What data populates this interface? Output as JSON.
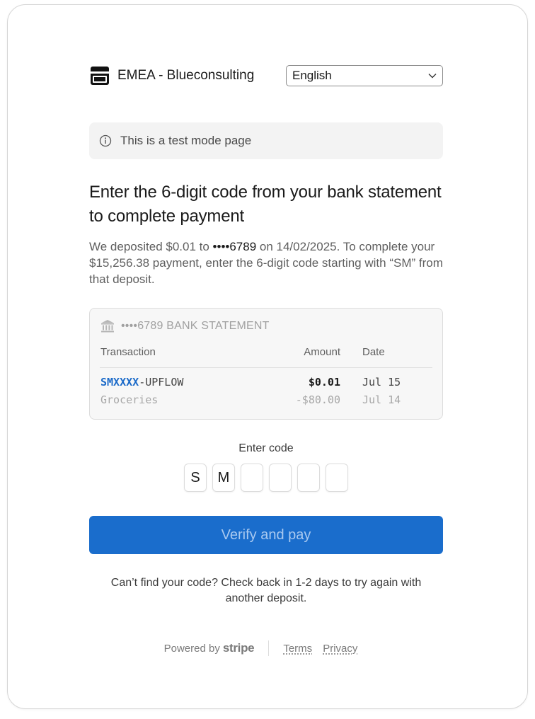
{
  "header": {
    "brand_name": "EMEA - Blueconsulting",
    "language": "English"
  },
  "banner": {
    "text": "This is a test mode page"
  },
  "main": {
    "title": "Enter the 6-digit code from your bank statement to complete payment",
    "desc_1": "We deposited $0.01 to ",
    "desc_mask": "••••6789",
    "desc_2": " on 14/02/2025. To complete your $15,256.38 payment, enter the 6-digit code starting with “SM” from that deposit."
  },
  "statement": {
    "heading": "••••6789 BANK STATEMENT",
    "columns": {
      "transaction": "Transaction",
      "amount": "Amount",
      "date": "Date"
    },
    "rows": [
      {
        "code": "SMXXXX",
        "suffix": "-UPFLOW",
        "amount": "$0.01",
        "date": "Jul 15"
      },
      {
        "code": "",
        "suffix": "Groceries",
        "amount": "-$80.00",
        "date": "Jul 14"
      }
    ]
  },
  "code_entry": {
    "label": "Enter code",
    "digits": [
      "S",
      "M",
      "",
      "",
      "",
      ""
    ]
  },
  "actions": {
    "verify_label": "Verify and pay"
  },
  "help_text": "Can’t find your code? Check back in 1-2 days to try again with another deposit.",
  "footer": {
    "powered_by": "Powered by",
    "brand": "stripe",
    "terms": "Terms",
    "privacy": "Privacy"
  },
  "colors": {
    "primary_button": "#1a6dcc",
    "highlight": "#1c6bc9"
  }
}
